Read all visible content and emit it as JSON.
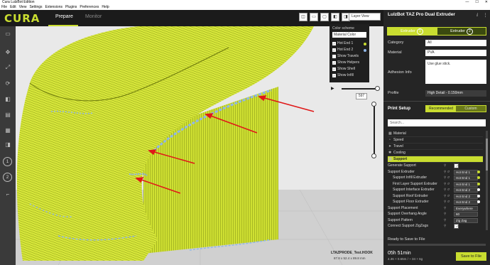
{
  "window": {
    "title": "Cura LulzBot Edition",
    "controls": [
      "—",
      "☐",
      "✕"
    ]
  },
  "menu": [
    "File",
    "Edit",
    "View",
    "Settings",
    "Extensions",
    "Plugins",
    "Preferences",
    "Help"
  ],
  "header": {
    "logo": "CURA",
    "tabs": [
      "Prepare",
      "Monitor"
    ],
    "active_tab": "Prepare"
  },
  "view": {
    "mode": "Layer View",
    "color_scheme_title": "Color scheme",
    "color_scheme_value": "Material Color",
    "legend": [
      {
        "label": "Hot End 1",
        "checked": true,
        "color": "#c9dd30"
      },
      {
        "label": "Hot End 2",
        "checked": true,
        "color": "#8fb6e8"
      },
      {
        "label": "Show Travels",
        "checked": false
      },
      {
        "label": "Show Helpers",
        "checked": true
      },
      {
        "label": "Show Shell",
        "checked": true
      },
      {
        "label": "Show Infill",
        "checked": true
      }
    ],
    "layer_number": "597"
  },
  "object": {
    "name": "LTAZPRODE_Test.HOOK",
    "dimensions": "87.8 x 52.4 x 89.8 mm"
  },
  "panel": {
    "printer": "LulzBot TAZ Pro Dual Extruder",
    "extruders": [
      {
        "label": "Extruder",
        "num": "1"
      },
      {
        "label": "Extruder",
        "num": "2"
      }
    ],
    "category_label": "Category",
    "category_value": "All",
    "material_label": "Material",
    "material_value": "PVA",
    "adhesion_label": "Adhesion Info",
    "adhesion_value": "Use glue stick.",
    "profile_label": "Profile",
    "profile_value": "High Detail - 0.150mm",
    "print_setup": "Print Setup",
    "mode_recommended": "Recommended",
    "mode_custom": "Custom",
    "search_placeholder": "Search...",
    "categories": [
      "Material",
      "Speed",
      "Travel",
      "Cooling",
      "Support"
    ],
    "settings": [
      {
        "label": "Generate Support",
        "value": "✓",
        "indent": false
      },
      {
        "label": "Support Extruder",
        "value": "Hot End 1",
        "indent": false
      },
      {
        "label": "Support Infill Extruder",
        "value": "Hot End 1",
        "indent": true
      },
      {
        "label": "First Layer Support Extruder",
        "value": "Hot End 1",
        "indent": true
      },
      {
        "label": "Support Interface Extruder",
        "value": "Hot End 2",
        "indent": true
      },
      {
        "label": "Support Roof Extruder",
        "value": "Hot End 2",
        "indent": true
      },
      {
        "label": "Support Floor Extruder",
        "value": "Hot End 2",
        "indent": true
      },
      {
        "label": "Support Placement",
        "value": "Everywhere",
        "indent": false
      },
      {
        "label": "Support Overhang Angle",
        "value": "60",
        "indent": false
      },
      {
        "label": "Support Pattern",
        "value": "Zig Zag",
        "indent": false
      },
      {
        "label": "Connect Support ZigZags",
        "value": "✓",
        "indent": false
      }
    ],
    "status": "Ready to Save to File",
    "time": "05h 51min",
    "filament": "4.36 + 0.65m / ~ 34 + 6g",
    "save_button": "Save to File"
  },
  "accent": "#c9dd30"
}
